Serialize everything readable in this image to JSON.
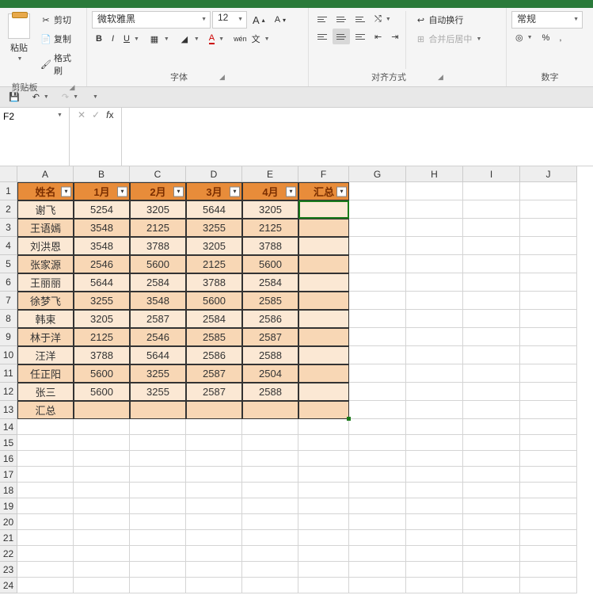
{
  "ribbon": {
    "clipboard": {
      "paste": "粘贴",
      "cut": "剪切",
      "copy": "复制",
      "format_painter": "格式刷",
      "label": "剪贴板"
    },
    "font": {
      "name": "微软雅黑",
      "size": "12",
      "bold": "B",
      "italic": "I",
      "underline": "U",
      "wen": "wén",
      "wen2": "文",
      "A_inc": "A",
      "A_dec": "A",
      "label": "字体"
    },
    "align": {
      "wrap": "自动换行",
      "merge": "合并后居中",
      "label": "对齐方式"
    },
    "number": {
      "general": "常规",
      "percent": "%",
      "comma": ",",
      "label": "数字"
    }
  },
  "namebox": "F2",
  "columns": [
    "A",
    "B",
    "C",
    "D",
    "E",
    "F",
    "G",
    "H",
    "I",
    "J"
  ],
  "table": {
    "headers": [
      "姓名",
      "1月",
      "2月",
      "3月",
      "4月",
      "汇总"
    ],
    "rows": [
      [
        "谢飞",
        "5254",
        "3205",
        "5644",
        "3205",
        ""
      ],
      [
        "王语嫣",
        "3548",
        "2125",
        "3255",
        "2125",
        ""
      ],
      [
        "刘洪恩",
        "3548",
        "3788",
        "3205",
        "3788",
        ""
      ],
      [
        "张家源",
        "2546",
        "5600",
        "2125",
        "5600",
        ""
      ],
      [
        "王丽丽",
        "5644",
        "2584",
        "3788",
        "2584",
        ""
      ],
      [
        "徐梦飞",
        "3255",
        "3548",
        "5600",
        "2585",
        ""
      ],
      [
        "韩束",
        "3205",
        "2587",
        "2584",
        "2586",
        ""
      ],
      [
        "林于洋",
        "2125",
        "2546",
        "2585",
        "2587",
        ""
      ],
      [
        "汪洋",
        "3788",
        "5644",
        "2586",
        "2588",
        ""
      ],
      [
        "任正阳",
        "5600",
        "3255",
        "2587",
        "2504",
        ""
      ],
      [
        "张三",
        "5600",
        "3255",
        "2587",
        "2588",
        ""
      ],
      [
        "汇总",
        "",
        "",
        "",
        "",
        ""
      ]
    ]
  },
  "rowcount": 24
}
